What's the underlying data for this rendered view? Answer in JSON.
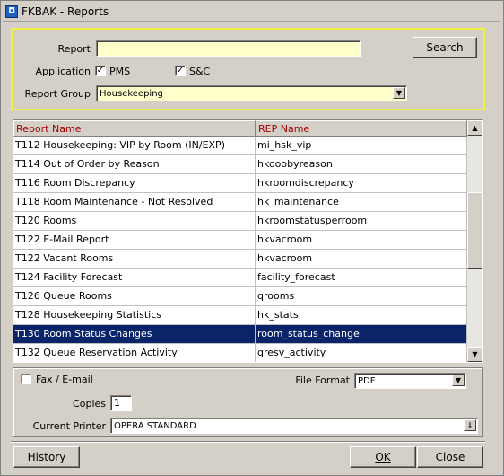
{
  "window": {
    "title": "FKBAK - Reports",
    "icon": "opera-app-icon"
  },
  "criteria": {
    "report_label": "Report",
    "report_value": "",
    "application_label": "Application",
    "pms_label": "PMS",
    "pms_checked": true,
    "sc_label": "S&C",
    "sc_checked": true,
    "report_group_label": "Report Group",
    "report_group_value": "Housekeeping",
    "search_button": "Search"
  },
  "grid": {
    "columns": [
      "Report Name",
      "REP Name"
    ],
    "rows": [
      [
        "T112 Housekeeping: VIP by Room (IN/EXP)",
        "mi_hsk_vip"
      ],
      [
        "T114 Out of Order by Reason",
        "hkooobyreason"
      ],
      [
        "T116 Room Discrepancy",
        "hkroomdiscrepancy"
      ],
      [
        "T118 Room Maintenance - Not Resolved",
        "hk_maintenance"
      ],
      [
        "T120 Rooms",
        "hkroomstatusperroom"
      ],
      [
        "T122 E-Mail Report",
        "hkvacroom"
      ],
      [
        "T122 Vacant Rooms",
        "hkvacroom"
      ],
      [
        "T124 Facility Forecast",
        "facility_forecast"
      ],
      [
        "T126 Queue Rooms",
        "qrooms"
      ],
      [
        "T128 Housekeeping Statistics",
        "hk_stats"
      ],
      [
        "T130 Room Status Changes",
        "room_status_change"
      ],
      [
        "T132 Queue Reservation Activity",
        "qresv_activity"
      ]
    ],
    "selected_index": 10
  },
  "output": {
    "fax_email_label": "Fax / E-mail",
    "fax_email_checked": false,
    "file_format_label": "File Format",
    "file_format_value": "PDF",
    "copies_label": "Copies",
    "copies_value": "1",
    "current_printer_label": "Current Printer",
    "current_printer_value": "OPERA STANDARD"
  },
  "buttons": {
    "history": "History",
    "ok": "OK",
    "close": "Close"
  },
  "colors": {
    "highlight": "#0a246a",
    "criteria_border": "#f0f040",
    "header_text": "#a00000",
    "field_bg": "#ffffcc"
  }
}
